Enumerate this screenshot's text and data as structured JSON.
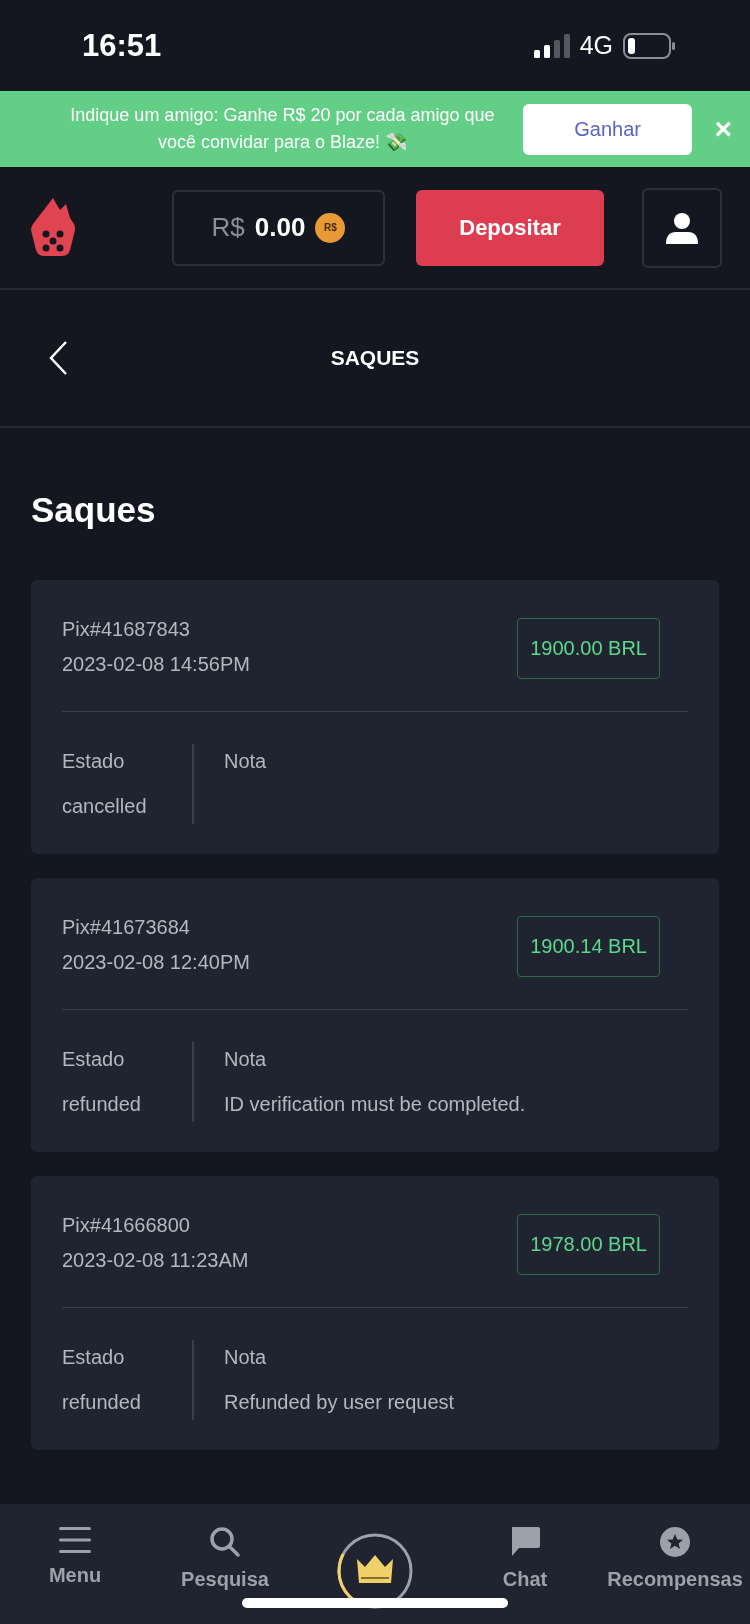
{
  "status_bar": {
    "time": "16:51",
    "network": "4G"
  },
  "banner": {
    "text": "Indique um amigo: Ganhe R$ 20 por cada amigo que você convidar para o Blaze! 💸",
    "button": "Ganhar",
    "close": "×"
  },
  "header": {
    "currency": "R$",
    "balance": "0.00",
    "coin": "R$",
    "deposit": "Depositar"
  },
  "page_header": {
    "title": "SAQUES"
  },
  "section_title": "Saques",
  "withdrawals": [
    {
      "id": "Pix#41687843",
      "datetime": "2023-02-08 14:56PM",
      "amount": "1900.00 BRL",
      "status_label": "Estado",
      "status": "cancelled",
      "note_label": "Nota"
    },
    {
      "id": "Pix#41673684",
      "datetime": "2023-02-08 12:40PM",
      "amount": "1900.14 BRL",
      "status_label": "Estado",
      "status": "refunded",
      "note_label": "Nota",
      "note": "ID verification must be completed."
    },
    {
      "id": "Pix#41666800",
      "datetime": "2023-02-08 11:23AM",
      "amount": "1978.00 BRL",
      "status_label": "Estado",
      "status": "refunded",
      "note_label": "Nota",
      "note": "Refunded by user request"
    }
  ],
  "bottom_nav": {
    "items": [
      {
        "label": "Menu"
      },
      {
        "label": "Pesquisa"
      },
      {
        "label": "Chat"
      },
      {
        "label": "Recompensas"
      }
    ],
    "vip": {
      "level": 0.3
    }
  }
}
